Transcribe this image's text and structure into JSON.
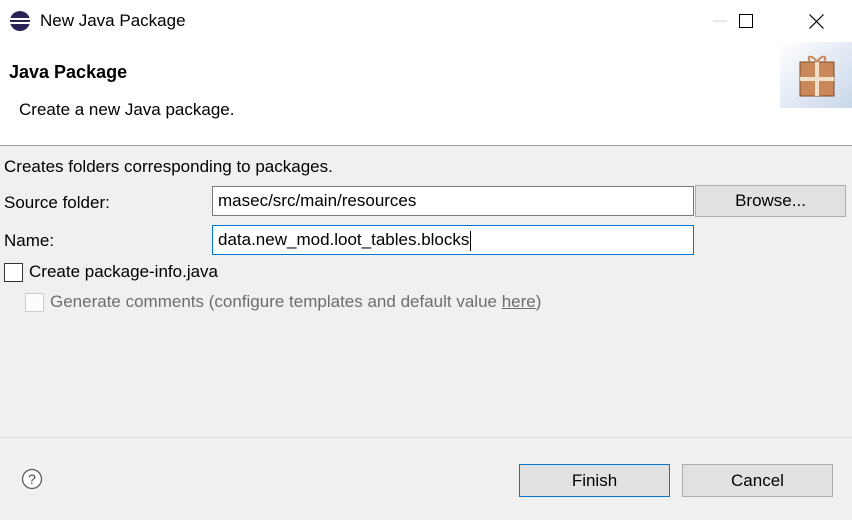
{
  "window": {
    "title": "New Java Package",
    "icon": "eclipse-icon"
  },
  "banner": {
    "title": "Java Package",
    "description": "Create a new Java package.",
    "image": "package-icon"
  },
  "form": {
    "info": "Creates folders corresponding to packages.",
    "source_folder_label": "Source folder:",
    "source_folder_value": "masec/src/main/resources",
    "browse_label": "Browse...",
    "name_label": "Name:",
    "name_value": "data.new_mod.loot_tables.blocks",
    "create_package_info_label": "Create package-info.java",
    "create_package_info_checked": false,
    "generate_comments_prefix": "Generate comments (configure templates and default value ",
    "generate_comments_link": "here",
    "generate_comments_suffix": ")",
    "generate_comments_enabled": false
  },
  "footer": {
    "help_icon": "help-icon",
    "finish_label": "Finish",
    "cancel_label": "Cancel"
  }
}
